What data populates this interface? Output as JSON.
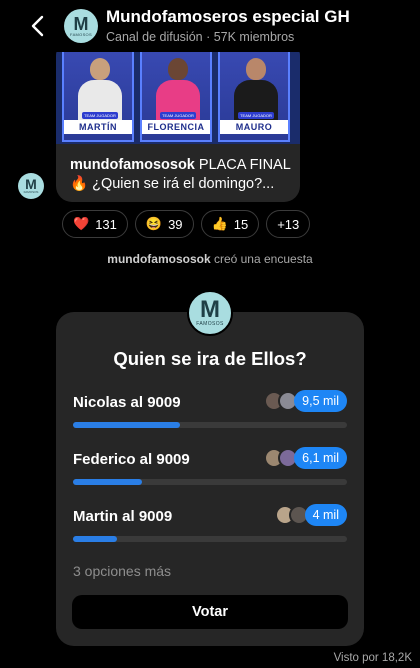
{
  "header": {
    "title": "Mundofamoseros especial GH",
    "subtitle": "Canal de difusión · 57K miembros",
    "avatar_letter": "M",
    "avatar_sub": "FAMOSOS"
  },
  "message": {
    "contestants": [
      {
        "name": "MARTÍN",
        "tag": "TEAM JUGADOR"
      },
      {
        "name": "FLORENCIA",
        "tag": "TEAM JUGADOR"
      },
      {
        "name": "MAURO",
        "tag": "TEAM JUGADOR"
      }
    ],
    "author": "mundofamososok",
    "text_line1": " PLACA FINAL",
    "text_line2": "🔥 ¿Quien se irá el domingo?..."
  },
  "reactions": [
    {
      "emoji": "❤️",
      "count": "131"
    },
    {
      "emoji": "😆",
      "count": "39"
    },
    {
      "emoji": "👍",
      "count": "15"
    },
    {
      "emoji": "",
      "count": "+13"
    }
  ],
  "system_line": {
    "author": "mundofamososok",
    "text": " creó una encuesta"
  },
  "poll": {
    "question": "Quien se ira de Ellos?",
    "options": [
      {
        "label": "Nicolas al 9009",
        "count": "9,5 mil",
        "fraction": 0.39
      },
      {
        "label": "Federico al 9009",
        "count": "6,1 mil",
        "fraction": 0.25
      },
      {
        "label": "Martin al 9009",
        "count": "4 mil",
        "fraction": 0.16
      }
    ],
    "more_options": "3 opciones más",
    "vote_label": "Votar"
  },
  "seen": "Visto por 18,2K",
  "colors": {
    "accent": "#1e86f5",
    "avatar_bg": "#a9dde0",
    "bubble_bg": "#262626"
  }
}
